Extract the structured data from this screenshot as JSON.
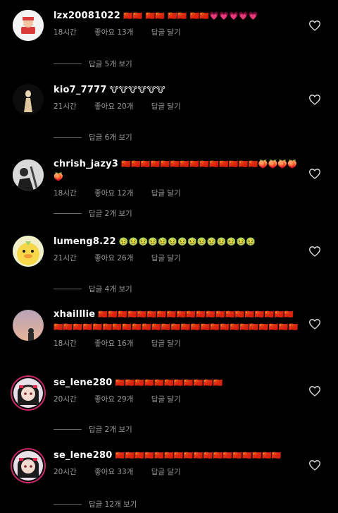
{
  "comments": [
    {
      "username": "lzx20081022",
      "emoji_text": "🇨🇳🇨🇳 🇨🇳🇨🇳 🇨🇳🇨🇳 🇨🇳🇨🇳💗💗💗💗💗",
      "time": "18시간",
      "likes": "좋아요 13개",
      "reply": "답글 달기",
      "view_replies": "답글 5개 보기"
    },
    {
      "username": "kio7_7777",
      "emoji_text": "🐮🐮🐮🐮🐮🐮",
      "time": "21시간",
      "likes": "좋아요 20개",
      "reply": "답글 달기",
      "view_replies": "답글 6개 보기"
    },
    {
      "username": "chrish_jazy3",
      "emoji_text": "🇨🇳🇨🇳🇨🇳🇨🇳🇨🇳🇨🇳🇨🇳🇨🇳🇨🇳🇨🇳🇨🇳🇨🇳🇨🇳🇨🇳🍑🍑🍑🍑🍑",
      "time": "18시간",
      "likes": "좋아요 12개",
      "reply": "답글 달기",
      "view_replies": "답글 2개 보기"
    },
    {
      "username": "lumeng8.22",
      "emoji_text": "🤢🤢🤢🤢🤢🤢🤢🤢🤢🤢🤢🤢🤢🤢",
      "time": "21시간",
      "likes": "좋아요 26개",
      "reply": "답글 달기",
      "view_replies": "답글 4개 보기"
    },
    {
      "username": "xhailllie",
      "emoji_text": "🇨🇳🇨🇳🇨🇳🇨🇳🇨🇳🇨🇳🇨🇳🇨🇳🇨🇳🇨🇳🇨🇳🇨🇳🇨🇳🇨🇳🇨🇳🇨🇳🇨🇳🇨🇳🇨🇳🇨🇳🇨🇳🇨🇳🇨🇳🇨🇳🇨🇳🇨🇳🇨🇳🇨🇳🇨🇳🇨🇳🇨🇳🇨🇳🇨🇳🇨🇳🇨🇳🇨🇳🇨🇳🇨🇳🇨🇳🇨🇳🇨🇳🇨🇳🇨🇳🇨🇳🇨🇳",
      "time": "18시간",
      "likes": "좋아요 16개",
      "reply": "답글 달기",
      "view_replies": ""
    },
    {
      "username": "se_lene280",
      "emoji_text": "🇨🇳🇨🇳🇨🇳🇨🇳🇨🇳🇨🇳🇨🇳🇨🇳🇨🇳🇨🇳🇨🇳",
      "time": "20시간",
      "likes": "좋아요 29개",
      "reply": "답글 달기",
      "view_replies": "답글 2개 보기"
    },
    {
      "username": "se_lene280",
      "emoji_text": "🇨🇳🇨🇳🇨🇳🇨🇳🇨🇳🇨🇳🇨🇳🇨🇳🇨🇳🇨🇳🇨🇳🇨🇳🇨🇳🇨🇳🇨🇳🇨🇳🇨🇳",
      "time": "20시간",
      "likes": "좋아요 33개",
      "reply": "답글 달기",
      "view_replies": "답글 12개 보기"
    }
  ],
  "icons": {
    "like": "heart-outline-icon"
  },
  "colors": {
    "background": "#000000",
    "text": "#ffffff",
    "secondary": "#9a9a9a",
    "story_ring": "#c8286a"
  }
}
